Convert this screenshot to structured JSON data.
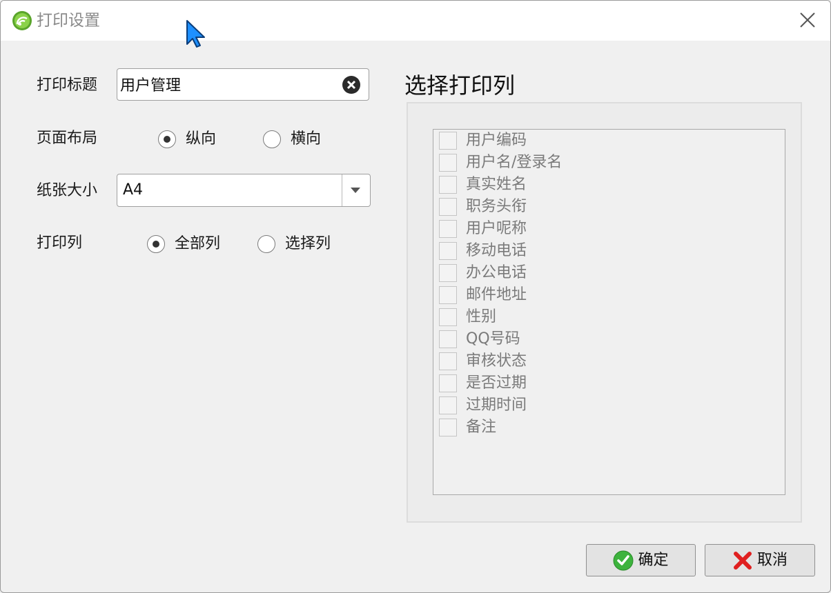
{
  "window": {
    "title": "打印设置"
  },
  "form": {
    "title_label": "打印标题",
    "title_value": "用户管理",
    "layout_label": "页面布局",
    "layout_options": [
      {
        "label": "纵向",
        "selected": true
      },
      {
        "label": "横向",
        "selected": false
      }
    ],
    "paper_label": "纸张大小",
    "paper_value": "A4",
    "columns_label": "打印列",
    "columns_options": [
      {
        "label": "全部列",
        "selected": true
      },
      {
        "label": "选择列",
        "selected": false
      }
    ]
  },
  "column_picker": {
    "title": "选择打印列",
    "items": [
      {
        "label": "用户编码",
        "checked": false
      },
      {
        "label": "用户名/登录名",
        "checked": false
      },
      {
        "label": "真实姓名",
        "checked": false
      },
      {
        "label": "职务头衔",
        "checked": false
      },
      {
        "label": "用户呢称",
        "checked": false
      },
      {
        "label": "移动电话",
        "checked": false
      },
      {
        "label": "办公电话",
        "checked": false
      },
      {
        "label": "邮件地址",
        "checked": false
      },
      {
        "label": "性别",
        "checked": false
      },
      {
        "label": "QQ号码",
        "checked": false
      },
      {
        "label": "审核状态",
        "checked": false
      },
      {
        "label": "是否过期",
        "checked": false
      },
      {
        "label": "过期时间",
        "checked": false
      },
      {
        "label": "备注",
        "checked": false
      }
    ]
  },
  "buttons": {
    "ok": "确定",
    "cancel": "取消"
  },
  "colors": {
    "ok_icon": "#3db33d",
    "cancel_icon": "#e02020",
    "cursor": "#1e90ff"
  },
  "icons": [
    "app-logo-icon",
    "close-icon",
    "clear-icon",
    "chevron-down-icon",
    "check-circle-icon",
    "x-mark-icon",
    "mouse-cursor-icon"
  ]
}
